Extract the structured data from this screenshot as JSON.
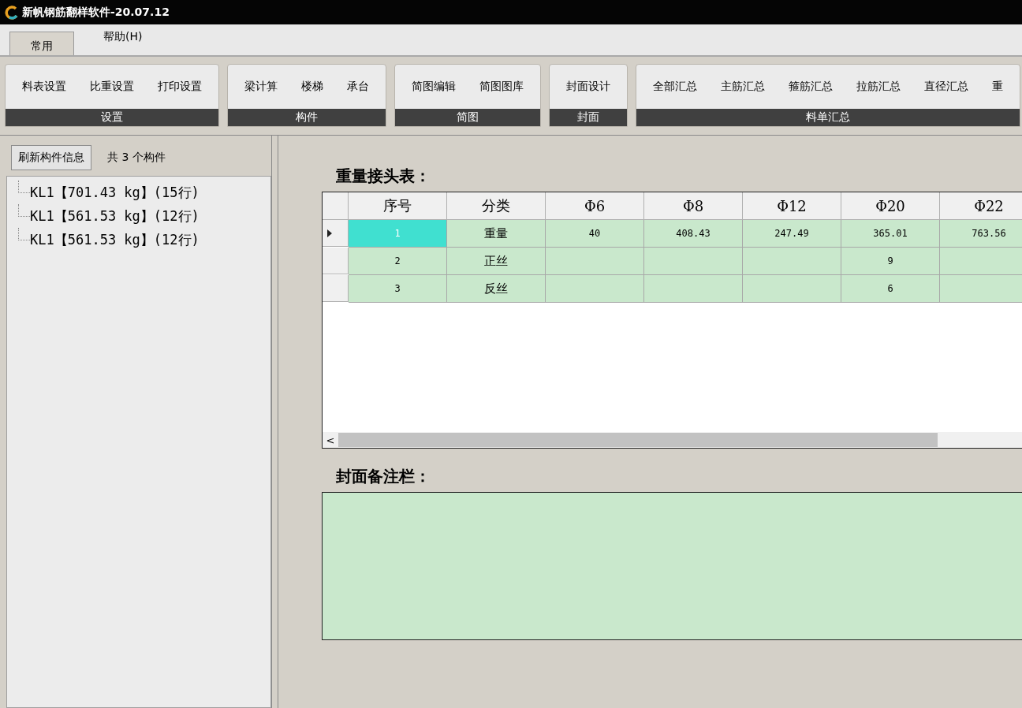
{
  "window": {
    "title": "新帆钢筋翻样软件-20.07.12"
  },
  "menu_tabs": [
    {
      "label": "常用",
      "selected": true
    },
    {
      "label": "帮助(H)",
      "selected": false
    }
  ],
  "ribbon_groups": [
    {
      "label": "设置",
      "buttons": [
        "料表设置",
        "比重设置",
        "打印设置"
      ]
    },
    {
      "label": "构件",
      "buttons": [
        "梁计算",
        "楼梯",
        "承台"
      ]
    },
    {
      "label": "简图",
      "buttons": [
        "简图编辑",
        "简图图库"
      ]
    },
    {
      "label": "封面",
      "buttons": [
        "封面设计"
      ]
    },
    {
      "label": "料单汇总",
      "buttons": [
        "全部汇总",
        "主筋汇总",
        "箍筋汇总",
        "拉筋汇总",
        "直径汇总",
        "重"
      ]
    }
  ],
  "left_panel": {
    "refresh_button": "刷新构件信息",
    "count_label": "共 3 个构件",
    "tree_items": [
      {
        "label": "KL1【701.43 kg】(15行)"
      },
      {
        "label": "KL1【561.53 kg】(12行)"
      },
      {
        "label": "KL1【561.53 kg】(12行)"
      }
    ]
  },
  "joint_table": {
    "title": "重量接头表：",
    "columns": [
      "序号",
      "分类",
      "Φ6",
      "Φ8",
      "Φ12",
      "Φ20",
      "Φ22"
    ],
    "rows": [
      {
        "selected": true,
        "cells": [
          "1",
          "重量",
          "40",
          "408.43",
          "247.49",
          "365.01",
          "763.56"
        ]
      },
      {
        "selected": false,
        "cells": [
          "2",
          "正丝",
          "",
          "",
          "",
          "9",
          ""
        ]
      },
      {
        "selected": false,
        "cells": [
          "3",
          "反丝",
          "",
          "",
          "",
          "6",
          ""
        ]
      }
    ],
    "scroll_left": "<"
  },
  "cover_notes": {
    "title": "封面备注栏："
  }
}
